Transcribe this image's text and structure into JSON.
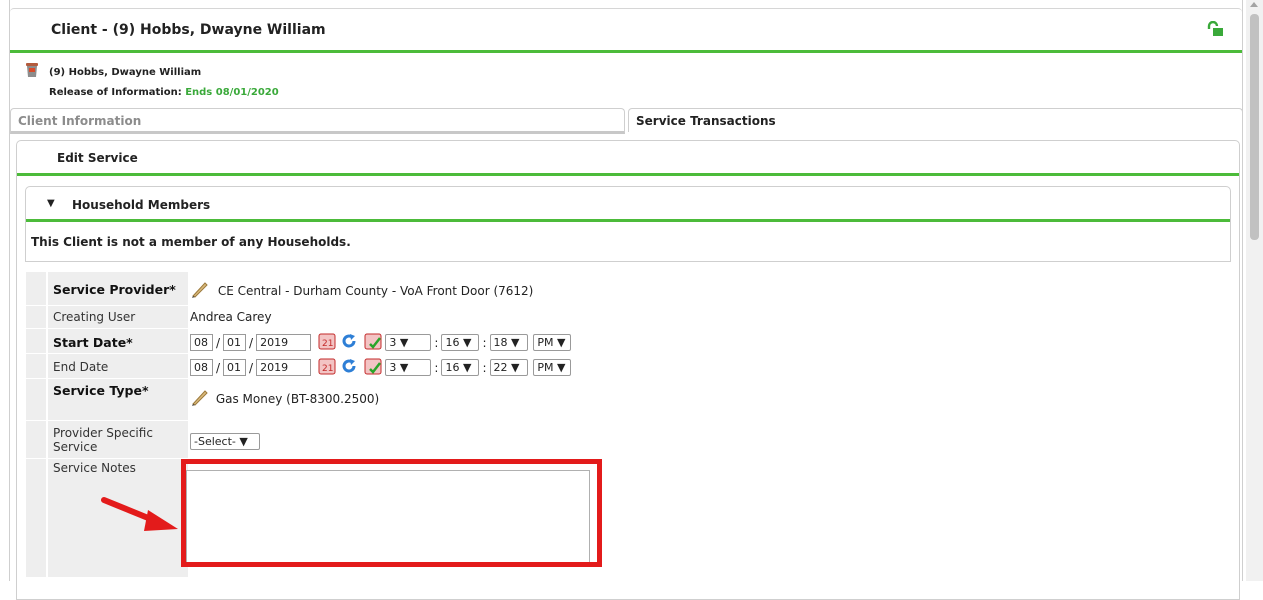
{
  "window": {
    "title": "Client - (9) Hobbs, Dwayne William"
  },
  "client": {
    "name": "(9) Hobbs, Dwayne William",
    "roi_label": "Release of Information:",
    "roi_value": "Ends 08/01/2020"
  },
  "tabs": [
    {
      "label": "Client Information",
      "active": false
    },
    {
      "label": "Service Transactions",
      "active": true
    }
  ],
  "edit_panel": {
    "title": "Edit Service"
  },
  "household": {
    "title": "Household Members",
    "message": "This Client is not a member of any Households."
  },
  "form": {
    "service_provider": {
      "label": "Service Provider",
      "required": "*",
      "value": "CE Central - Durham County - VoA Front Door (7612)"
    },
    "creating_user": {
      "label": "Creating User",
      "value": "Andrea Carey"
    },
    "start_date": {
      "label": "Start Date",
      "required": "*",
      "month": "08",
      "day": "01",
      "year": "2019",
      "hour": "3",
      "minute": "16",
      "second": "18",
      "ampm": "PM"
    },
    "end_date": {
      "label": "End Date",
      "month": "08",
      "day": "01",
      "year": "2019",
      "hour": "3",
      "minute": "16",
      "second": "22",
      "ampm": "PM"
    },
    "service_type": {
      "label": "Service Type",
      "required": "*",
      "value": "Gas Money (BT-8300.2500)"
    },
    "provider_specific": {
      "label": "Provider Specific Service",
      "selected": "-Select-"
    },
    "service_notes": {
      "label": "Service Notes",
      "value": ""
    }
  },
  "colors": {
    "accent_green": "#4cbb3a",
    "highlight_red": "#e31b1b"
  },
  "icons": [
    "lock-open-icon",
    "client-trash-icon",
    "pencil-icon",
    "calendar-icon",
    "refresh-icon",
    "calendar-check-icon",
    "dropdown-arrow-icon",
    "red-arrow-annotation"
  ]
}
